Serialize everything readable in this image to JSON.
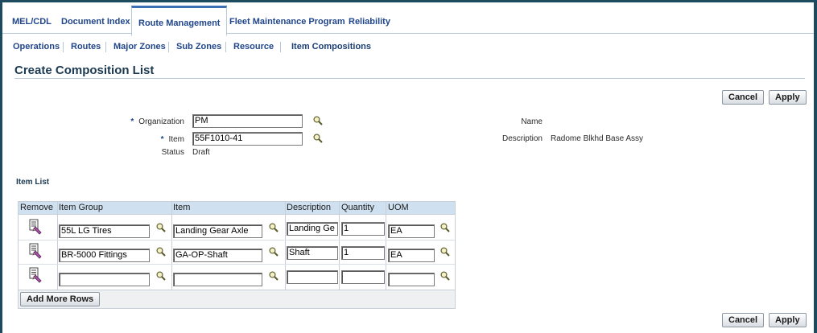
{
  "tabs": [
    {
      "label": "MEL/CDL"
    },
    {
      "label": "Document Index"
    },
    {
      "label": "Route Management"
    },
    {
      "label": "Fleet Maintenance Program"
    },
    {
      "label": "Reliability"
    }
  ],
  "subtabs": [
    {
      "label": "Operations"
    },
    {
      "label": "Routes"
    },
    {
      "label": "Major Zones"
    },
    {
      "label": "Sub Zones"
    },
    {
      "label": "Resource"
    },
    {
      "label": "Item Compositions"
    }
  ],
  "page_title": "Create Composition List",
  "buttons": {
    "cancel": "Cancel",
    "apply": "Apply",
    "add_more_rows": "Add More Rows"
  },
  "form": {
    "required_mark": "*",
    "organization_label": "Organization",
    "organization_value": "PM",
    "item_label": "Item",
    "item_value": "55F1010-41",
    "status_label": "Status",
    "status_value": "Draft",
    "name_label": "Name",
    "description_label": "Description",
    "description_value": "Radome Blkhd Base Assy"
  },
  "item_list": {
    "title": "Item List",
    "columns": [
      "Remove",
      "Item Group",
      "Item",
      "Description",
      "Quantity",
      "UOM"
    ],
    "rows": [
      {
        "item_group": "55L LG Tires",
        "item": "Landing Gear Axle",
        "description": "Landing Ge",
        "quantity": "1",
        "uom": "EA"
      },
      {
        "item_group": "BR-5000 Fittings",
        "item": "GA-OP-Shaft",
        "description": "Shaft",
        "quantity": "1",
        "uom": "EA"
      },
      {
        "item_group": "",
        "item": "",
        "description": "",
        "quantity": "",
        "uom": ""
      }
    ]
  }
}
